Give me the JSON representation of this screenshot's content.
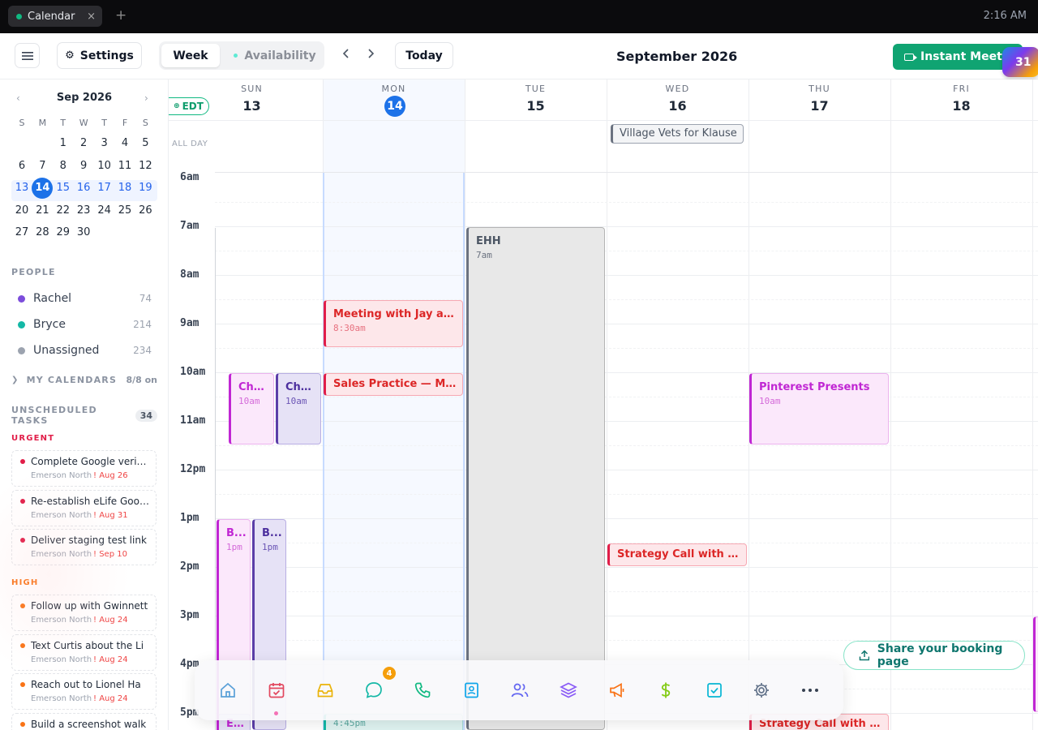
{
  "topbar": {
    "tab_label": "Calendar",
    "tab_close": "×",
    "new_tab": "+",
    "clock": "2:16 AM"
  },
  "header": {
    "settings_label": "Settings",
    "week_label": "Week",
    "availability_label": "Availability",
    "today_label": "Today",
    "month_title": "September 2026",
    "instant_meeting_label": "Instant Meeting",
    "badge_label": "31"
  },
  "mini_calendar": {
    "month_label": "Sep 2026",
    "dow": [
      "S",
      "M",
      "T",
      "W",
      "T",
      "F",
      "S"
    ],
    "weeks": [
      [
        "",
        "",
        "1",
        "2",
        "3",
        "4",
        "5"
      ],
      [
        "6",
        "7",
        "8",
        "9",
        "10",
        "11",
        "12"
      ],
      [
        "13",
        "14",
        "15",
        "16",
        "17",
        "18",
        "19"
      ],
      [
        "20",
        "21",
        "22",
        "23",
        "24",
        "25",
        "26"
      ],
      [
        "27",
        "28",
        "29",
        "30",
        "",
        "",
        ""
      ]
    ],
    "selected_week": 2,
    "today": "14"
  },
  "people": {
    "title": "PEOPLE",
    "items": [
      {
        "name": "Rachel",
        "count": "74",
        "color": "#7c4ddb"
      },
      {
        "name": "Bryce",
        "count": "214",
        "color": "#14b8a6"
      },
      {
        "name": "Unassigned",
        "count": "234",
        "color": "#9ca3af"
      }
    ]
  },
  "my_calendars": {
    "label": "MY CALENDARS",
    "count": "8/8 on"
  },
  "unscheduled": {
    "title": "UNSCHEDULED TASKS",
    "count": "34",
    "urgent_label": "URGENT",
    "high_label": "HIGH",
    "urgent": [
      {
        "title": "Complete Google verification",
        "assignee": "Emerson North",
        "due": "! Aug 26"
      },
      {
        "title": "Re-establish eLife Google",
        "assignee": "Emerson North",
        "due": "! Aug 31"
      },
      {
        "title": "Deliver staging test link",
        "assignee": "Emerson North",
        "due": "! Sep 10"
      }
    ],
    "high": [
      {
        "title": "Follow up with Gwinnett",
        "assignee": "Emerson North",
        "due": "! Aug 24"
      },
      {
        "title": "Text Curtis about the Li",
        "assignee": "Emerson North",
        "due": "! Aug 24"
      },
      {
        "title": "Reach out to Lionel Ha",
        "assignee": "Emerson North",
        "due": "! Aug 24"
      },
      {
        "title": "Build a screenshot walk",
        "assignee": "Emerson North",
        "due": "! Aug 24"
      }
    ]
  },
  "calendar": {
    "timezone_label": "EDT",
    "allday_label": "ALL DAY",
    "days": [
      {
        "dow": "SUN",
        "num": "13"
      },
      {
        "dow": "MON",
        "num": "14",
        "today": true
      },
      {
        "dow": "TUE",
        "num": "15"
      },
      {
        "dow": "WED",
        "num": "16"
      },
      {
        "dow": "THU",
        "num": "17"
      },
      {
        "dow": "FRI",
        "num": "18"
      }
    ],
    "hours": [
      "6am",
      "7am",
      "8am",
      "9am",
      "10am",
      "11am",
      "12pm",
      "1pm",
      "2pm",
      "3pm",
      "4pm",
      "5pm"
    ],
    "allday_event": "Village Vets for Klause",
    "events": {
      "ehh": {
        "title": "EHH",
        "time": "7am"
      },
      "meeting_jay": {
        "title": "Meeting with Jay and Br...",
        "time": "8:30am"
      },
      "sales_practice": {
        "title": "Sales Practice — Mock C..."
      },
      "church1": {
        "title": "Chur...",
        "time": "10am"
      },
      "church2": {
        "title": "Chur...",
        "time": "10am"
      },
      "pinterest": {
        "title": "Pinterest Presents",
        "time": "10am"
      },
      "b1": {
        "title": "B...",
        "time": "1pm"
      },
      "b2": {
        "title": "B...",
        "time": "1pm"
      },
      "strategy_nolen": {
        "title": "Strategy Call with Nolen"
      },
      "strategy_kima": {
        "title": "Strategy Call with Kima..."
      },
      "el": {
        "title": "El..."
      },
      "mon_late": {
        "time": "4:45pm"
      }
    }
  },
  "dock": {
    "notif_count": "4"
  },
  "share_label": "Share your booking page",
  "colors": {
    "accent_green": "#10a472",
    "today_blue": "#1d72e8",
    "urgent_red": "#e11d48",
    "high_orange": "#f97316"
  }
}
